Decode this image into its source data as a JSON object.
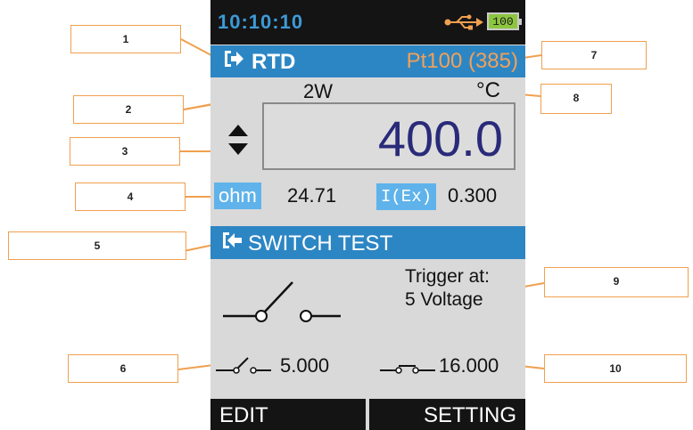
{
  "status": {
    "time": "10:10:10",
    "battery": "100"
  },
  "rtd": {
    "mode": "RTD",
    "sensor_type": "Pt100 (385)",
    "wire": "2W",
    "unit": "°C",
    "reading": "400.0"
  },
  "params": {
    "ohm_label": "ohm",
    "ohm_value": "24.71",
    "iex_label": "I(Ex)",
    "iex_value": "0.300"
  },
  "switch_test": {
    "title": "SWITCH TEST",
    "trigger_line1": "Trigger at:",
    "trigger_line2": "5 Voltage",
    "open_value": "5.000",
    "close_value": "16.000"
  },
  "softkeys": {
    "left": "EDIT",
    "right": "SETTING"
  },
  "callouts": [
    "1",
    "2",
    "3",
    "4",
    "5",
    "6",
    "7",
    "8",
    "9",
    "10"
  ],
  "colors": {
    "accent_blue": "#2d86c4",
    "callout_border": "#f0a050",
    "sensor_text": "#f0a05a",
    "reading_text": "#2a2a7a"
  }
}
